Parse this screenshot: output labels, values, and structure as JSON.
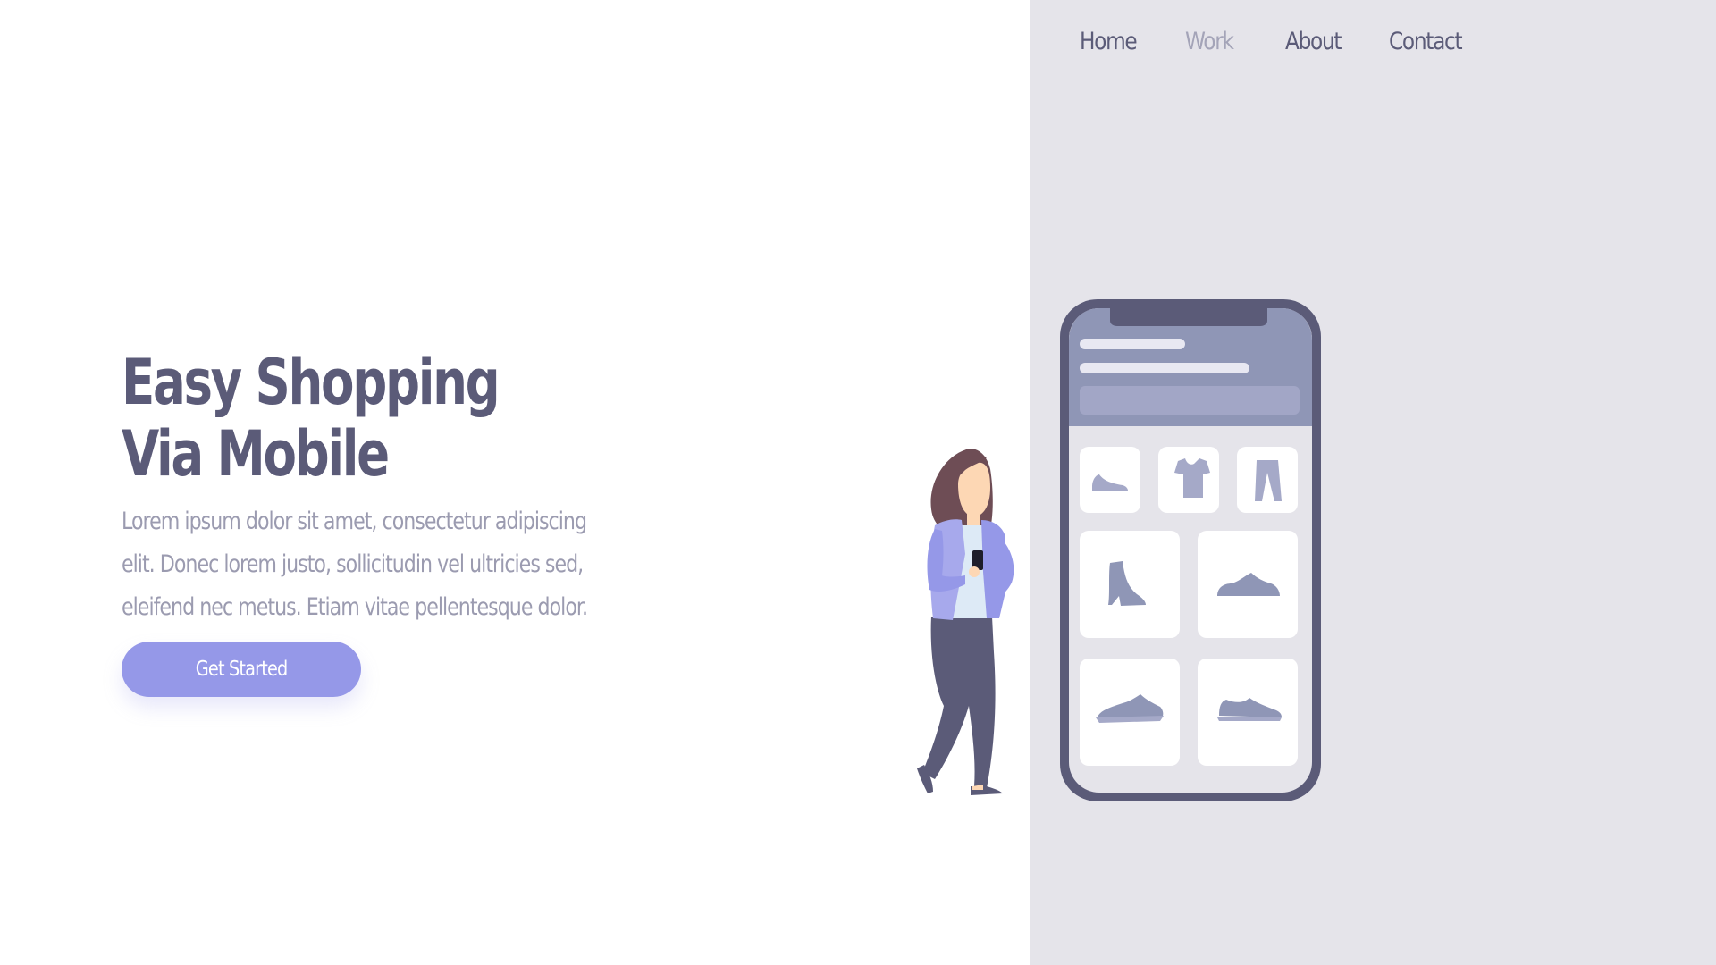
{
  "nav": {
    "items": [
      {
        "label": "Home"
      },
      {
        "label": "Work"
      },
      {
        "label": "About"
      },
      {
        "label": "Contact"
      }
    ]
  },
  "hero": {
    "title_line1": "Easy Shopping",
    "title_line2": "Via Mobile",
    "description": "Lorem ipsum dolor sit amet, consectetur adipiscing elit. Donec lorem justo, sollicitudin vel ultricies sed, eleifend nec metus. Etiam vitae pellentesque dolor.",
    "cta_label": "Get Started"
  },
  "colors": {
    "primary_text": "#5b5b78",
    "muted_text": "#9b9bb0",
    "accent": "#9598e8",
    "right_panel_bg": "#e5e4ea"
  },
  "icons": [
    "flat-shoe-icon",
    "tshirt-icon",
    "pants-icon",
    "boot-icon",
    "sneaker-icon",
    "running-shoe-icon",
    "low-shoe-icon"
  ]
}
